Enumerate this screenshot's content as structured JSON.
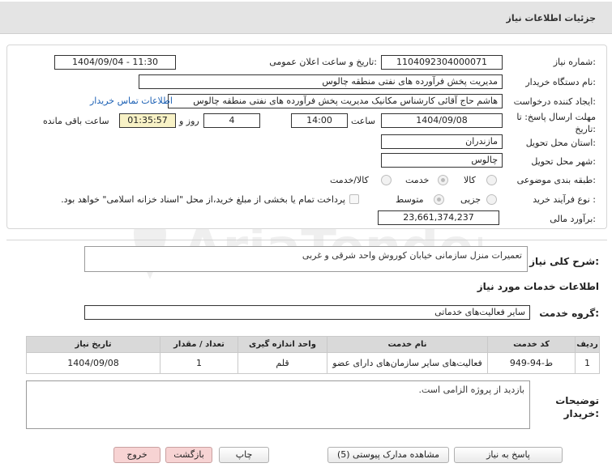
{
  "header": {
    "title": "جزئیات اطلاعات نیاز"
  },
  "fields": {
    "need_number_label": "شماره نیاز:",
    "need_number": "1104092304000071",
    "announce_label": "تاریخ و ساعت اعلان عمومی:",
    "announce_value": "1404/09/04 - 11:30",
    "buyer_org_label": "نام دستگاه خریدار:",
    "buyer_org": "مدیریت پخش فرآورده های نفتی منطقه چالوس",
    "requester_label": "ایجاد کننده درخواست:",
    "requester": "هاشم حاج آقائی کارشناس مکانیک  مدیریت پخش فرآورده های نفتی منطقه چالوس",
    "contact_link": "اطلاعات تماس خریدار",
    "deadline_label": "مهلت ارسال پاسخ: تا",
    "deadline_label2": "تاریخ:",
    "deadline_date": "1404/09/08",
    "time_label": "ساعت",
    "deadline_time": "14:00",
    "days_value": "4",
    "days_label": "روز و",
    "remaining_time": "01:35:57",
    "remaining_label": "ساعت باقی مانده",
    "province_label": "استان محل تحویل:",
    "province": "مازندران",
    "city_label": "شهر محل تحویل:",
    "city": "چالوس",
    "category_label": "طبقه بندی موضوعی:",
    "category_options": [
      "کالا",
      "خدمت",
      "کالا/خدمت"
    ],
    "process_label": "نوع فرآیند خرید :",
    "process_options": [
      "جزیی",
      "متوسط"
    ],
    "payment_note": "پرداخت تمام یا بخشی از مبلغ خرید،از محل \"اسناد خزانه اسلامی\" خواهد بود.",
    "budget_label": "برآورد مالی:",
    "budget": "23,661,374,237"
  },
  "description": {
    "label": "شرح کلی نیاز:",
    "value": "تعمیرات منزل سازمانی خیابان کوروش واحد شرقی و غربی"
  },
  "services": {
    "section_title": "اطلاعات خدمات مورد نیاز",
    "group_label": "گروه خدمت:",
    "group_value": "سایر فعالیت‌های خدماتی",
    "columns": [
      "ردیف",
      "کد خدمت",
      "نام خدمت",
      "واحد اندازه گیری",
      "تعداد / مقدار",
      "تاریخ نیاز"
    ],
    "rows": [
      [
        "1",
        "ط-94-949",
        "فعالیت‌های سایر سازمان‌های دارای عضو",
        "قلم",
        "1",
        "1404/09/08"
      ]
    ]
  },
  "buyer_notes": {
    "label_line1": "توضیحات",
    "label_line2": "خریدار:",
    "value": "بازدید از پروژه الزامی است."
  },
  "buttons": {
    "reply": "پاسخ به نیاز",
    "attachments": "مشاهده مدارک پیوستی (5)",
    "print": "چاپ",
    "back": "بازگشت",
    "exit": "خروج"
  },
  "watermark_text": "AriaTender.neT",
  "colors": {
    "header_bg": "#e4e4e4",
    "remaining_bg": "#f8f2c6",
    "link": "#1a5fb4",
    "pink_button": "#f7d3d3"
  }
}
